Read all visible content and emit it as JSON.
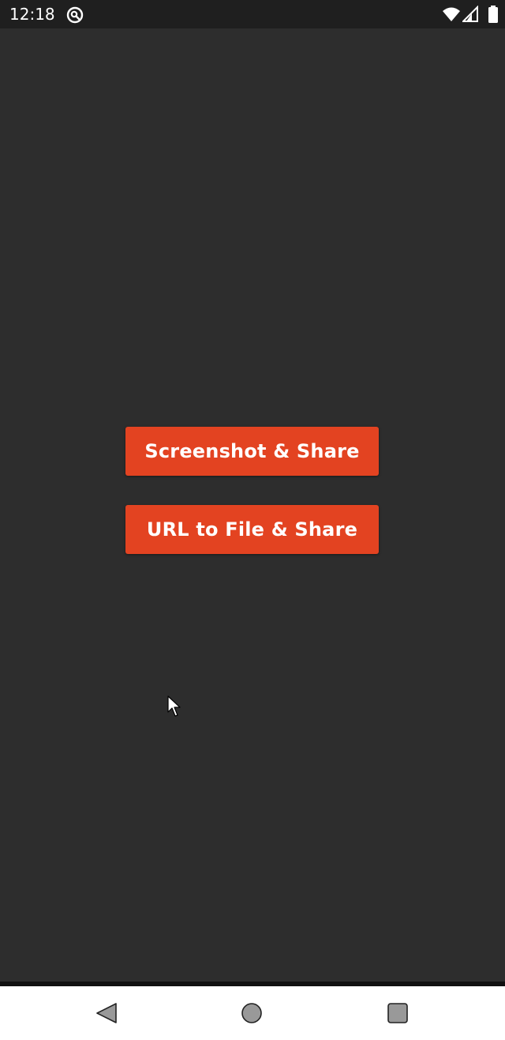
{
  "status_bar": {
    "time": "12:18",
    "app_icon": "vpn-key-icon",
    "wifi_icon": "wifi-icon",
    "signal_icon": "cell-signal-icon",
    "battery_icon": "battery-icon",
    "background_color": "#1f1f1f"
  },
  "main": {
    "background_color": "#2d2d2d",
    "buttons": [
      {
        "label": "Screenshot & Share",
        "color": "#e34321"
      },
      {
        "label": "URL to File & Share",
        "color": "#e34321"
      }
    ]
  },
  "navigation_bar": {
    "back_icon": "back-triangle-icon",
    "home_icon": "home-circle-icon",
    "recents_icon": "recents-square-icon",
    "background_color": "#ffffff"
  }
}
